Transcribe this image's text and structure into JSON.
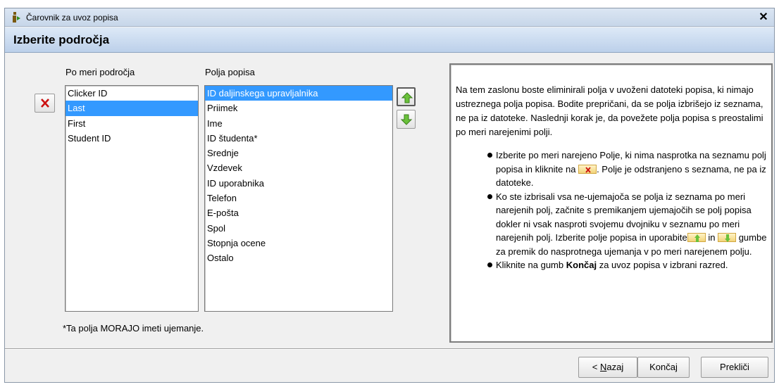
{
  "window": {
    "title": "Čarovnik za uvoz popisa"
  },
  "header": {
    "title": "Izberite področja"
  },
  "custom_fields": {
    "label": "Po meri področja",
    "items": [
      "Clicker ID",
      "Last",
      "First",
      "Student ID"
    ],
    "selected": "Last"
  },
  "roster_fields": {
    "label": "Polja popisa",
    "items": [
      "ID daljinskega upravljalnika",
      "Priimek",
      "Ime",
      "ID študenta*",
      "Srednje",
      "Vzdevek",
      "ID uporabnika",
      "Telefon",
      "E-pošta",
      "Spol",
      "Stopnja ocene",
      "Ostalo"
    ],
    "selected": "ID daljinskega upravljalnika"
  },
  "footnote": "*Ta polja MORAJO imeti ujemanje.",
  "info": {
    "intro": "Na tem zaslonu boste eliminirali polja v uvoženi datoteki popisa, ki nimajo ustreznega polja popisa. Bodite prepričani, da se polja izbrišejo iz seznama, ne pa iz datoteke. Naslednji korak je, da povežete polja popisa s preostalimi po meri narejenimi polji.",
    "b1_part1": "Izberite po meri narejeno Polje, ki nima nasprotka na seznamu polj popisa in kliknite na ",
    "b1_part2": ". Polje je odstranjeno s seznama, ne pa iz datoteke.",
    "b2_part1": "Ko ste izbrisali vsa ne-ujemajoča se polja iz seznama po meri narejenih polj, začnite s premikanjem ujemajočih se polj popisa dokler ni vsak nasproti svojemu dvojniku v seznamu po meri narejenih polj. Izberite polje popisa in uporabite",
    "b2_part2": " in ",
    "b2_part3": " gumbe za premik do nasprotnega ujemanja v po meri narejenem polju.",
    "b3_part1": "Kliknite na gumb ",
    "b3_bold": "Končaj",
    "b3_part2": " za uvoz popisa v izbrani razred."
  },
  "buttons": {
    "back_prefix": "< ",
    "back_key": "N",
    "back_rest": "azaj",
    "finish": "Končaj",
    "cancel": "Prekliči"
  },
  "colors": {
    "selection": "#3399ff",
    "header_gradient": "#bcd0ea",
    "delete_icon": "#cc1111",
    "arrow_icon": "#5cb82a"
  },
  "icons": {
    "delete": "red-x-icon",
    "up": "green-up-arrow-icon",
    "down": "green-down-arrow-icon",
    "app": "info-icon"
  }
}
